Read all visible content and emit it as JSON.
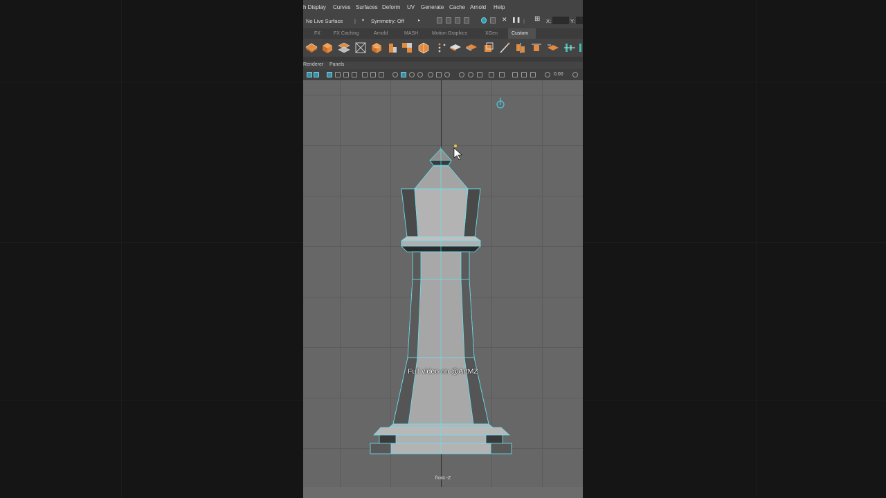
{
  "menu": [
    "h Display",
    "Curves",
    "Surfaces",
    "Deform",
    "UV",
    "Generate",
    "Cache",
    "Arnold",
    "Help"
  ],
  "status_line": {
    "live_surface": "No Live Surface",
    "symmetry": "Symmetry: Off",
    "x_label": "X:",
    "y_label": "Y:"
  },
  "shelf_tabs": [
    "FX",
    "FX Caching",
    "Arnold",
    "MASH",
    "Motion Graphics",
    "XGen",
    "Custom"
  ],
  "active_shelf_tab": "Custom",
  "panel_menu": [
    "Renderer",
    "Panels"
  ],
  "panel_toolbar": {
    "value": "0.00"
  },
  "viewport": {
    "camera_label": "front -Z",
    "overlay_text": "Full video on @ArtMZ"
  },
  "colors": {
    "wire": "#68e1ef",
    "accent_orange": "#e38a3c"
  }
}
